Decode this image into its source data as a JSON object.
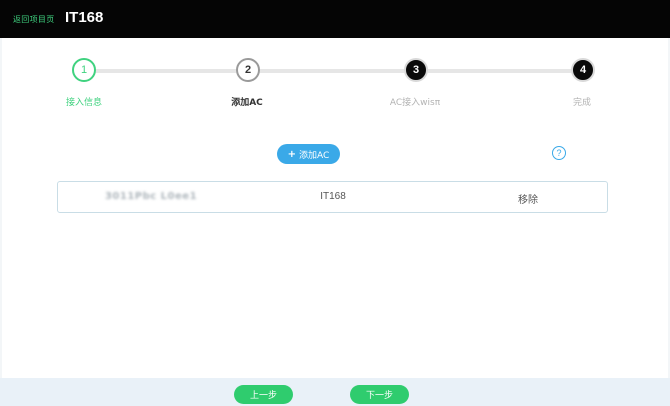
{
  "header": {
    "back_link": "返回项目页",
    "title": "IT168"
  },
  "steps": [
    {
      "number": "1",
      "label": "接入信息",
      "state": "done"
    },
    {
      "number": "2",
      "label": "添加AC",
      "state": "current"
    },
    {
      "number": "3",
      "label": "AC接入wisπ",
      "state": "pending"
    },
    {
      "number": "4",
      "label": "完成",
      "state": "pending"
    }
  ],
  "actions": {
    "add_ac_icon": "+",
    "add_ac_label": "添加AC",
    "help_icon": "?"
  },
  "ac_list": [
    {
      "serial": "3011Pbc L0ee1",
      "name": "IT168",
      "action": "移除"
    }
  ],
  "footer": {
    "prev_label": "上一步",
    "next_label": "下一步"
  },
  "colors": {
    "accent_green": "#2fcc6e",
    "accent_blue": "#3aa9e8",
    "header_bg": "#050505"
  }
}
